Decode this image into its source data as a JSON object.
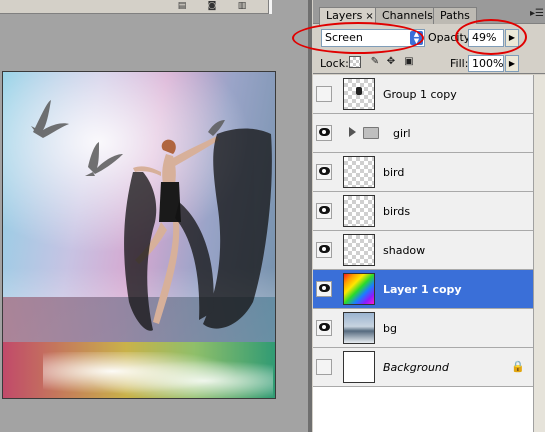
{
  "canvas": {
    "doc_strip_icons": [
      "document-info-icon",
      "camera-icon",
      "trash-icon"
    ]
  },
  "panel": {
    "tabs": [
      {
        "label": "Layers",
        "active": true,
        "close": "×"
      },
      {
        "label": "Channels",
        "active": false
      },
      {
        "label": "Paths",
        "active": false
      }
    ],
    "blend_mode": "Screen",
    "opacity_label": "Opacity:",
    "opacity_value": "49%",
    "lock_label": "Lock:",
    "fill_label": "Fill:",
    "fill_value": "100%"
  },
  "layers": [
    {
      "name": "Group 1 copy",
      "visible": false,
      "italic": false,
      "selected": false
    },
    {
      "name": "girl",
      "visible": true,
      "italic": false,
      "selected": false,
      "group": true
    },
    {
      "name": "bird",
      "visible": true,
      "italic": false,
      "selected": false
    },
    {
      "name": "birds",
      "visible": true,
      "italic": false,
      "selected": false
    },
    {
      "name": "shadow",
      "visible": true,
      "italic": false,
      "selected": false
    },
    {
      "name": "Layer 1 copy",
      "visible": true,
      "italic": false,
      "selected": true
    },
    {
      "name": "bg",
      "visible": true,
      "italic": false,
      "selected": false
    },
    {
      "name": "Background",
      "visible": false,
      "italic": true,
      "selected": false,
      "locked": true
    }
  ],
  "annotations": {
    "color": "#e00000"
  }
}
